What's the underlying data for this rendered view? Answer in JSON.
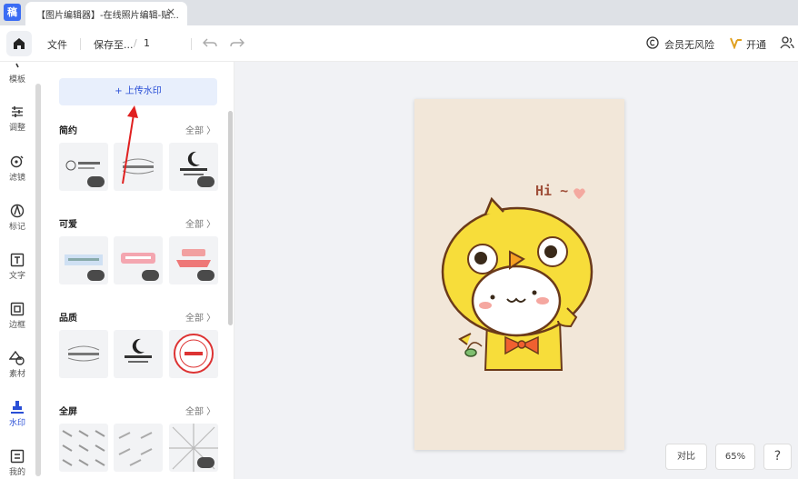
{
  "app": {
    "icon_text": "稿"
  },
  "tab": {
    "title": "【图片编辑器】-在线照片编辑-贴...",
    "close": "×"
  },
  "toolbar": {
    "file": "文件",
    "save_to": "保存至...",
    "page_sep": "/",
    "page_number": "1",
    "member_no_risk": "会员无风险",
    "activate": "开通"
  },
  "rail": {
    "items": [
      {
        "label": "模板",
        "icon": "template-icon"
      },
      {
        "label": "调整",
        "icon": "sliders-icon"
      },
      {
        "label": "滤镜",
        "icon": "filter-icon"
      },
      {
        "label": "标记",
        "icon": "pen-icon"
      },
      {
        "label": "文字",
        "icon": "text-icon"
      },
      {
        "label": "边框",
        "icon": "frame-icon"
      },
      {
        "label": "素材",
        "icon": "shapes-icon"
      },
      {
        "label": "水印",
        "icon": "watermark-icon"
      },
      {
        "label": "我的",
        "icon": "my-icon"
      }
    ]
  },
  "panel": {
    "upload": "+ 上传水印",
    "sections": [
      {
        "title": "简约",
        "all": "全部 〉"
      },
      {
        "title": "可爱",
        "all": "全部 〉"
      },
      {
        "title": "品质",
        "all": "全部 〉"
      },
      {
        "title": "全屏",
        "all": "全部 〉"
      }
    ]
  },
  "canvas": {
    "image_text": "Hi ~",
    "compare": "对比",
    "zoom": "65%",
    "help": "?"
  },
  "colors": {
    "accent": "#2a4fd6",
    "canvas_bg": "#f1f2f5",
    "image_bg": "#f2e7d9"
  }
}
